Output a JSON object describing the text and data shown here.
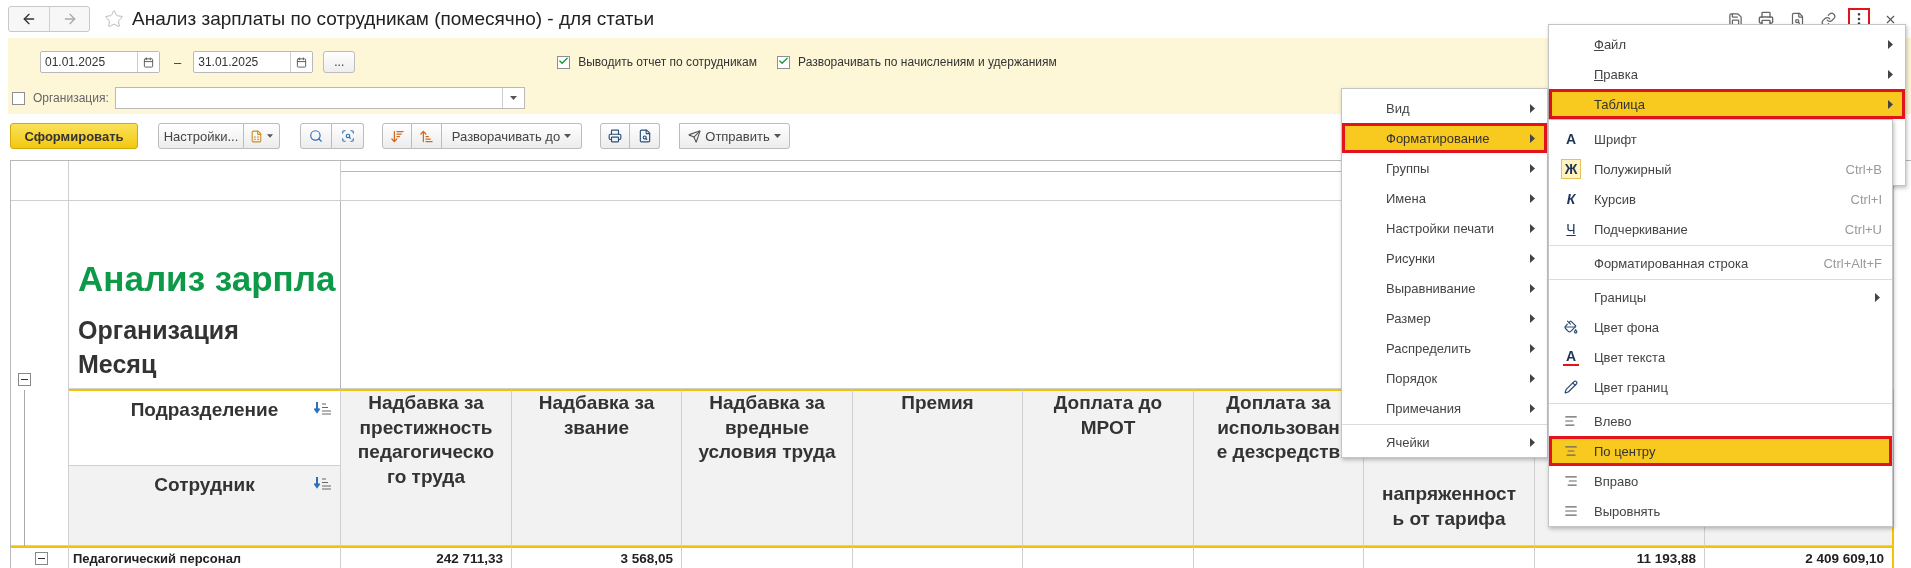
{
  "window": {
    "title": "Анализ зарплаты по сотрудникам (помесячно) - для статьи",
    "favorite": false
  },
  "filters": {
    "date_from": "01.01.2025",
    "date_separator": "–",
    "date_to": "31.01.2025",
    "period_button": "...",
    "options": [
      {
        "label": "Выводить отчет по сотрудникам",
        "checked": true
      },
      {
        "label": "Разворачивать по начислениям и удержаниям",
        "checked": true
      }
    ],
    "organization": {
      "label": "Организация:",
      "checked": false
    }
  },
  "toolbar": {
    "generate": "Сформировать",
    "settings": "Настройки...",
    "expand": "Разворачивать до",
    "send": "Отправить"
  },
  "report": {
    "title": "Анализ зарпла",
    "params": [
      "Организация",
      "Месяц"
    ],
    "row_headers": [
      "Подразделение",
      "Сотрудник"
    ],
    "columns": [
      {
        "kind": "full",
        "lines": [
          "Надбавка за",
          "престижность",
          "педагогическо",
          "го труда"
        ]
      },
      {
        "kind": "full",
        "lines": [
          "Надбавка за",
          "звание"
        ]
      },
      {
        "kind": "full",
        "lines": [
          "Надбавка за",
          "вредные",
          "условия труда"
        ]
      },
      {
        "kind": "full",
        "lines": [
          "Премия"
        ]
      },
      {
        "kind": "full",
        "lines": [
          "Доплата до",
          "МРОТ"
        ]
      },
      {
        "kind": "full",
        "lines": [
          "Доплата за",
          "использован",
          "е дезсредств"
        ]
      },
      {
        "kind": "tail",
        "lines": [
          "напряженност",
          "ь от тарифа"
        ]
      }
    ],
    "rows": [
      {
        "label": "Педагогический персонал",
        "expanded": true,
        "values": [
          "242 711,33",
          "3 568,05"
        ],
        "totals": [
          "11 193,88",
          "2 409 609,10"
        ]
      }
    ]
  },
  "main_menu": {
    "items": [
      {
        "label": "Файл",
        "underline_first": true,
        "selected": false
      },
      {
        "label": "Правка",
        "underline_first": true,
        "selected": false
      },
      {
        "label": "Таблица",
        "underline_first": false,
        "selected": true
      }
    ]
  },
  "table_menu": {
    "items": [
      {
        "kind": "item",
        "label": "Вид",
        "selected": false
      },
      {
        "kind": "item",
        "label": "Форматирование",
        "selected": true
      },
      {
        "kind": "item",
        "label": "Группы",
        "selected": false
      },
      {
        "kind": "item",
        "label": "Имена",
        "selected": false
      },
      {
        "kind": "item",
        "label": "Настройки печати",
        "selected": false
      },
      {
        "kind": "item",
        "label": "Рисунки",
        "selected": false
      },
      {
        "kind": "item",
        "label": "Выравнивание",
        "selected": false
      },
      {
        "kind": "item",
        "label": "Размер",
        "selected": false
      },
      {
        "kind": "item",
        "label": "Распределить",
        "selected": false
      },
      {
        "kind": "item",
        "label": "Порядок",
        "selected": false
      },
      {
        "kind": "item",
        "label": "Примечания",
        "selected": false
      },
      {
        "kind": "separator"
      },
      {
        "kind": "item",
        "label": "Ячейки",
        "selected": false
      }
    ]
  },
  "format_menu": {
    "items": [
      {
        "kind": "item",
        "glyph": "A",
        "label": "Шрифт",
        "selected": false
      },
      {
        "kind": "item",
        "glyph": "Ж",
        "label": "Полужирный",
        "shortcut": "Ctrl+B",
        "checked": true,
        "selected": false
      },
      {
        "kind": "item",
        "glyph": "К",
        "label": "Курсив",
        "shortcut": "Ctrl+I",
        "checked": false,
        "selected": false
      },
      {
        "kind": "item",
        "glyph": "Ч",
        "label": "Подчеркивание",
        "shortcut": "Ctrl+U",
        "checked": false,
        "selected": false
      },
      {
        "kind": "separator"
      },
      {
        "kind": "item",
        "label": "Форматированная строка",
        "shortcut": "Ctrl+Alt+F",
        "selected": false
      },
      {
        "kind": "separator"
      },
      {
        "kind": "item",
        "label": "Границы",
        "submenu": true,
        "selected": false
      },
      {
        "kind": "item",
        "label": "Цвет фона",
        "selected": false
      },
      {
        "kind": "item",
        "glyph": "A",
        "label": "Цвет текста",
        "selected": false
      },
      {
        "kind": "item",
        "label": "Цвет границ",
        "selected": false
      },
      {
        "kind": "separator"
      },
      {
        "kind": "item",
        "label": "Влево",
        "selected": false
      },
      {
        "kind": "item",
        "label": "По центру",
        "selected": true
      },
      {
        "kind": "item",
        "label": "Вправо",
        "selected": false
      },
      {
        "kind": "item",
        "label": "Выровнять",
        "selected": false
      }
    ]
  }
}
